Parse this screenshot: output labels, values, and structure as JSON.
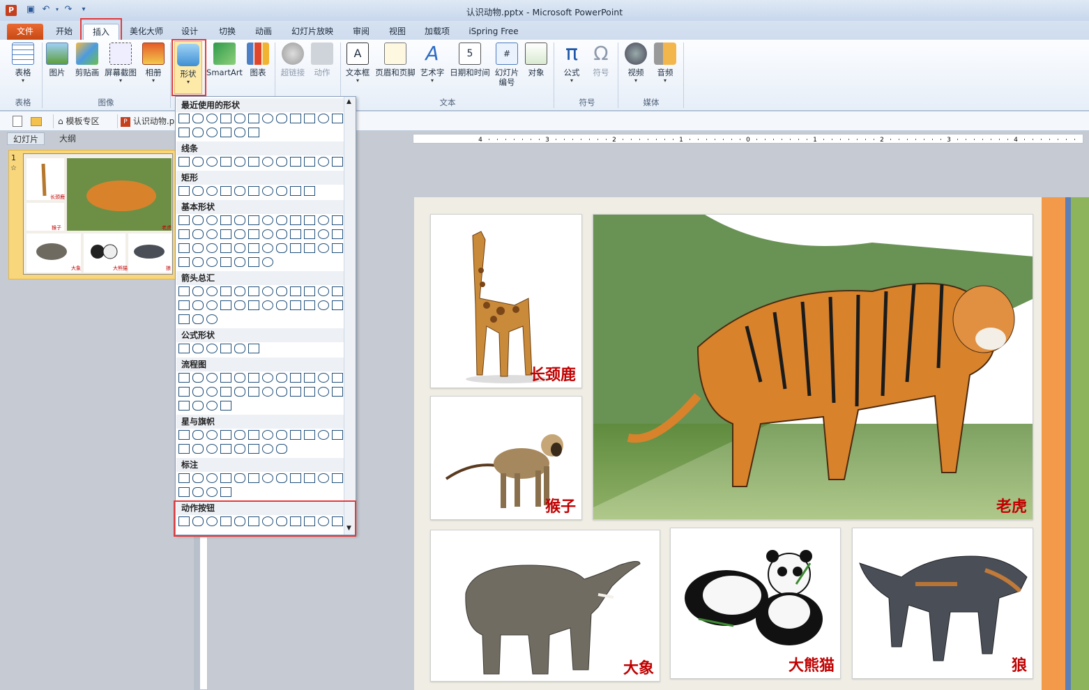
{
  "window": {
    "title": "认识动物.pptx - Microsoft PowerPoint",
    "app_icon": "P"
  },
  "quick_access": [
    "save-icon",
    "undo-icon",
    "redo-icon",
    "customize-icon"
  ],
  "tabs": [
    "文件",
    "开始",
    "插入",
    "美化大师",
    "设计",
    "切换",
    "动画",
    "幻灯片放映",
    "审阅",
    "视图",
    "加载项",
    "iSpring Free"
  ],
  "ribbon": {
    "table": "表格",
    "picture": "图片",
    "clipart": "剪贴画",
    "screenshot": "屏幕截图",
    "album": "相册",
    "shapes": "形状",
    "smartart": "SmartArt",
    "chart": "图表",
    "hyperlink": "超链接",
    "action": "动作",
    "textbox": "文本框",
    "header_footer": "页眉和页脚",
    "wordart": "艺术字",
    "datetime": "日期和时间",
    "slide_number_1": "幻灯片",
    "slide_number_2": "编号",
    "object": "对象",
    "equation": "公式",
    "symbol": "符号",
    "video": "视频",
    "audio": "音频",
    "groups": {
      "table": "表格",
      "images": "图像",
      "text": "文本",
      "symbols": "符号",
      "media": "媒体"
    }
  },
  "docbar": {
    "template_tab": "模板专区",
    "file_tab": "认识动物.p"
  },
  "leftpane": {
    "tab_slides": "幻灯片",
    "tab_outline": "大纲",
    "slide_number": "1",
    "star": "☆"
  },
  "dropdown": {
    "sections": [
      "最近使用的形状",
      "线条",
      "矩形",
      "基本形状",
      "箭头总汇",
      "公式形状",
      "流程图",
      "星与旗帜",
      "标注",
      "动作按钮"
    ]
  },
  "ruler": {
    "labels": [
      "4",
      "3",
      "2",
      "1",
      "0",
      "1",
      "2",
      "3",
      "4"
    ]
  },
  "slide": {
    "giraffe": "长颈鹿",
    "monkey": "猴子",
    "tiger": "老虎",
    "elephant": "大象",
    "panda": "大熊猫",
    "wolf": "狼"
  },
  "thumb": {
    "giraffe": "长颈鹿",
    "monkey": "猴子",
    "tiger": "老虎",
    "elephant": "大象",
    "panda": "大熊猫",
    "wolf": "狼"
  },
  "colors": {
    "accent_file": "#d9541c",
    "highlight": "#e23a3a",
    "label_red": "#c00000",
    "stripe_orange": "#f39a4a",
    "stripe_blue": "#5b7fb6",
    "stripe_green": "#8db45a"
  }
}
